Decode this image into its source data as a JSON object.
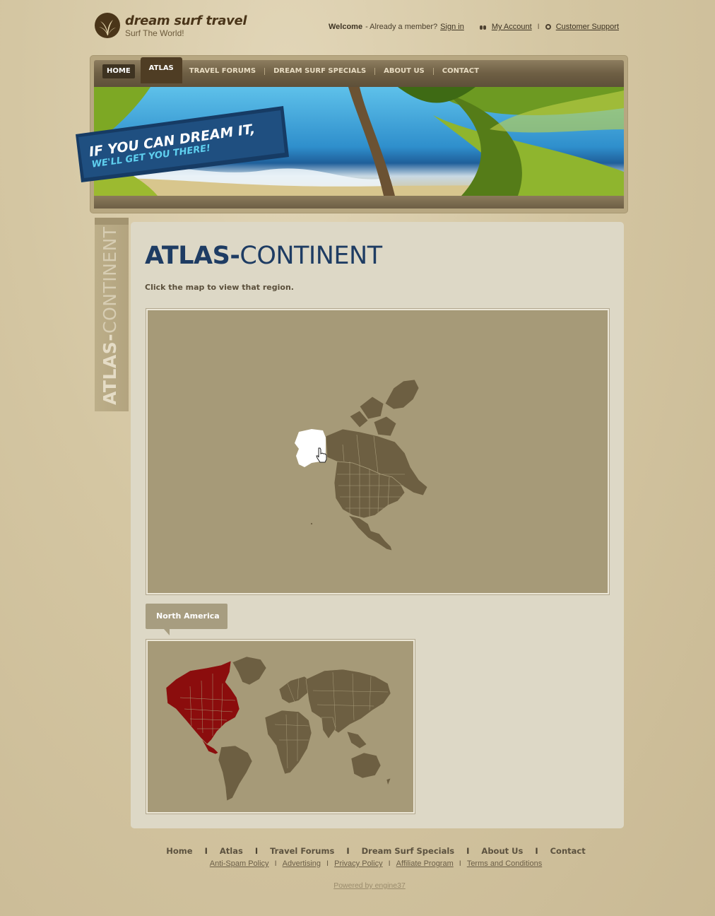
{
  "brand": {
    "name": "dream surf travel",
    "tagline": "Surf The World!"
  },
  "top_links": {
    "welcome": "Welcome",
    "member_prompt": "- Already a member?",
    "sign_in": "Sign in",
    "my_account": "My Account",
    "separator": "I",
    "customer_support": "Customer Support"
  },
  "nav": {
    "items": [
      {
        "label": "HOME",
        "state": "home"
      },
      {
        "label": "ATLAS",
        "state": "active"
      },
      {
        "label": "TRAVEL FORUMS"
      },
      {
        "label": "DREAM SURF SPECIALS"
      },
      {
        "label": "ABOUT US"
      },
      {
        "label": "CONTACT"
      }
    ]
  },
  "hero": {
    "line1": "IF YOU CAN DREAM IT,",
    "line2": "WE'LL GET YOU THERE!"
  },
  "side_tab": {
    "bold": "ATLAS-",
    "light": "CONTINENT"
  },
  "main": {
    "title_bold": "ATLAS-",
    "title_light": "CONTINENT",
    "intro": "Click the map to view that region.",
    "selected_region": "North America"
  },
  "colors": {
    "title": "#1e3c63",
    "map_bg": "#a69a78",
    "land": "#6d5f42",
    "highlight": "#8b0d0d",
    "hover_region": "#ffffff"
  },
  "footer": {
    "nav": [
      "Home",
      "Atlas",
      "Travel Forums",
      "Dream Surf Specials",
      "About Us",
      "Contact"
    ],
    "nav_separator": "I",
    "links": [
      "Anti-Spam Policy",
      "Advertising",
      "Privacy Policy",
      "Affiliate Program",
      "Terms and Conditions"
    ],
    "link_separator": "I",
    "powered": "Powered by engine37"
  }
}
